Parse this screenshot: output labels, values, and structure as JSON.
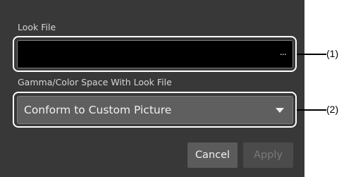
{
  "dialog": {
    "look_file": {
      "label": "Look File",
      "value": "",
      "browse_glyph": "..."
    },
    "gamma": {
      "label": "Gamma/Color Space With Look File",
      "selected": "Conform to Custom Picture",
      "icon": "chevron-down-icon"
    },
    "buttons": {
      "cancel": "Cancel",
      "apply": "Apply"
    }
  },
  "callouts": [
    "(1)",
    "(2)"
  ],
  "colors": {
    "dialog_bg": "#383838",
    "field_bg": "#000000",
    "select_bg": "#5f5f5f",
    "button_bg": "#5b5b5b",
    "highlight": "#ffffff"
  }
}
